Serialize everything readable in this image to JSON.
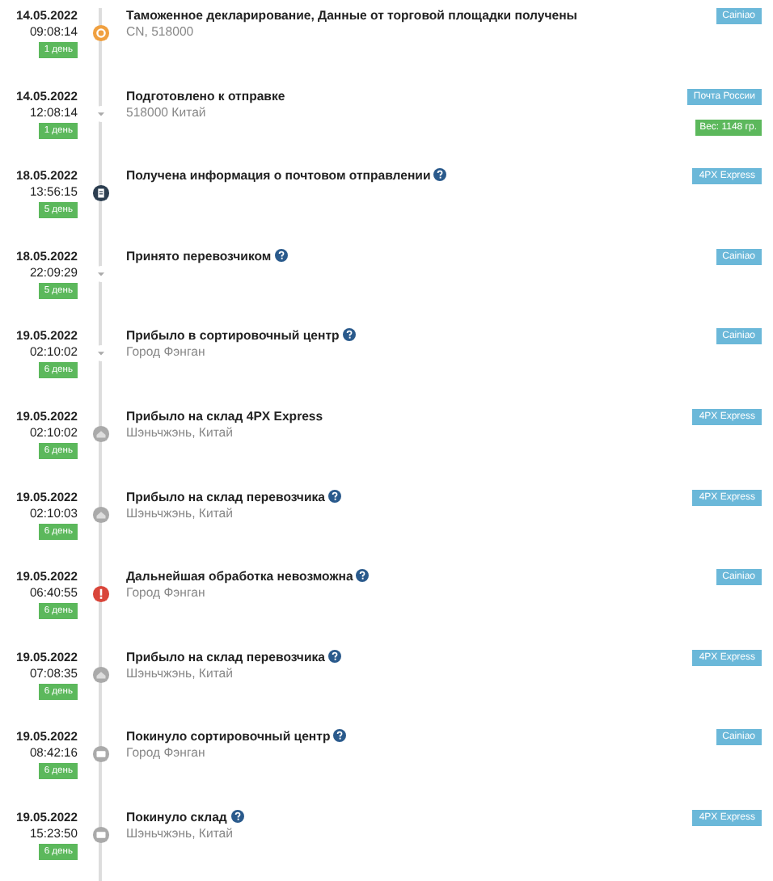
{
  "events": [
    {
      "date": "14.05.2022",
      "time": "09:08:14",
      "days": "1 день",
      "kind": "customs",
      "title": "Таможенное декларирование, Данные от торговой площадки получены",
      "help": false,
      "location": "CN, 518000",
      "carrier": "Cainiao"
    },
    {
      "date": "14.05.2022",
      "time": "12:08:14",
      "days": "1 день",
      "kind": "step",
      "title": "Подготовлено к отправке",
      "help": false,
      "location": "518000 Китай",
      "carrier": "Почта России",
      "weight": "Вес: 1148 гр."
    },
    {
      "date": "18.05.2022",
      "time": "13:56:15",
      "days": "5 день",
      "kind": "info",
      "title": "Получена информация о почтовом отправлении",
      "help": true,
      "carrier": "4PX Express"
    },
    {
      "date": "18.05.2022",
      "time": "22:09:29",
      "days": "5 день",
      "kind": "step",
      "title": "Принято перевозчиком",
      "help": true,
      "carrier": "Cainiao"
    },
    {
      "date": "19.05.2022",
      "time": "02:10:02",
      "days": "6 день",
      "kind": "step",
      "title": "Прибыло в сортировочный центр",
      "help": true,
      "location": "Город Фэнган",
      "carrier": "Cainiao"
    },
    {
      "date": "19.05.2022",
      "time": "02:10:02",
      "days": "6 день",
      "kind": "warehouse",
      "title": "Прибыло на склад 4PX Express",
      "help": false,
      "location": "Шэньчжэнь, Китай",
      "carrier": "4PX Express"
    },
    {
      "date": "19.05.2022",
      "time": "02:10:03",
      "days": "6 день",
      "kind": "warehouse",
      "title": "Прибыло на склад перевозчика",
      "help": true,
      "location": "Шэньчжэнь, Китай",
      "carrier": "4PX Express"
    },
    {
      "date": "19.05.2022",
      "time": "06:40:55",
      "days": "6 день",
      "kind": "error",
      "title": "Дальнейшая обработка невозможна",
      "help": true,
      "location": "Город Фэнган",
      "carrier": "Cainiao"
    },
    {
      "date": "19.05.2022",
      "time": "07:08:35",
      "days": "6 день",
      "kind": "warehouse",
      "title": "Прибыло на склад перевозчика",
      "help": true,
      "location": "Шэньчжэнь, Китай",
      "carrier": "4PX Express"
    },
    {
      "date": "19.05.2022",
      "time": "08:42:16",
      "days": "6 день",
      "kind": "truck",
      "title": "Покинуло сортировочный центр",
      "help": true,
      "location": "Город Фэнган",
      "carrier": "Cainiao"
    },
    {
      "date": "19.05.2022",
      "time": "15:23:50",
      "days": "6 день",
      "kind": "truck",
      "title": "Покинуло склад",
      "help": true,
      "location": "Шэньчжэнь, Китай",
      "carrier": "4PX Express"
    }
  ]
}
